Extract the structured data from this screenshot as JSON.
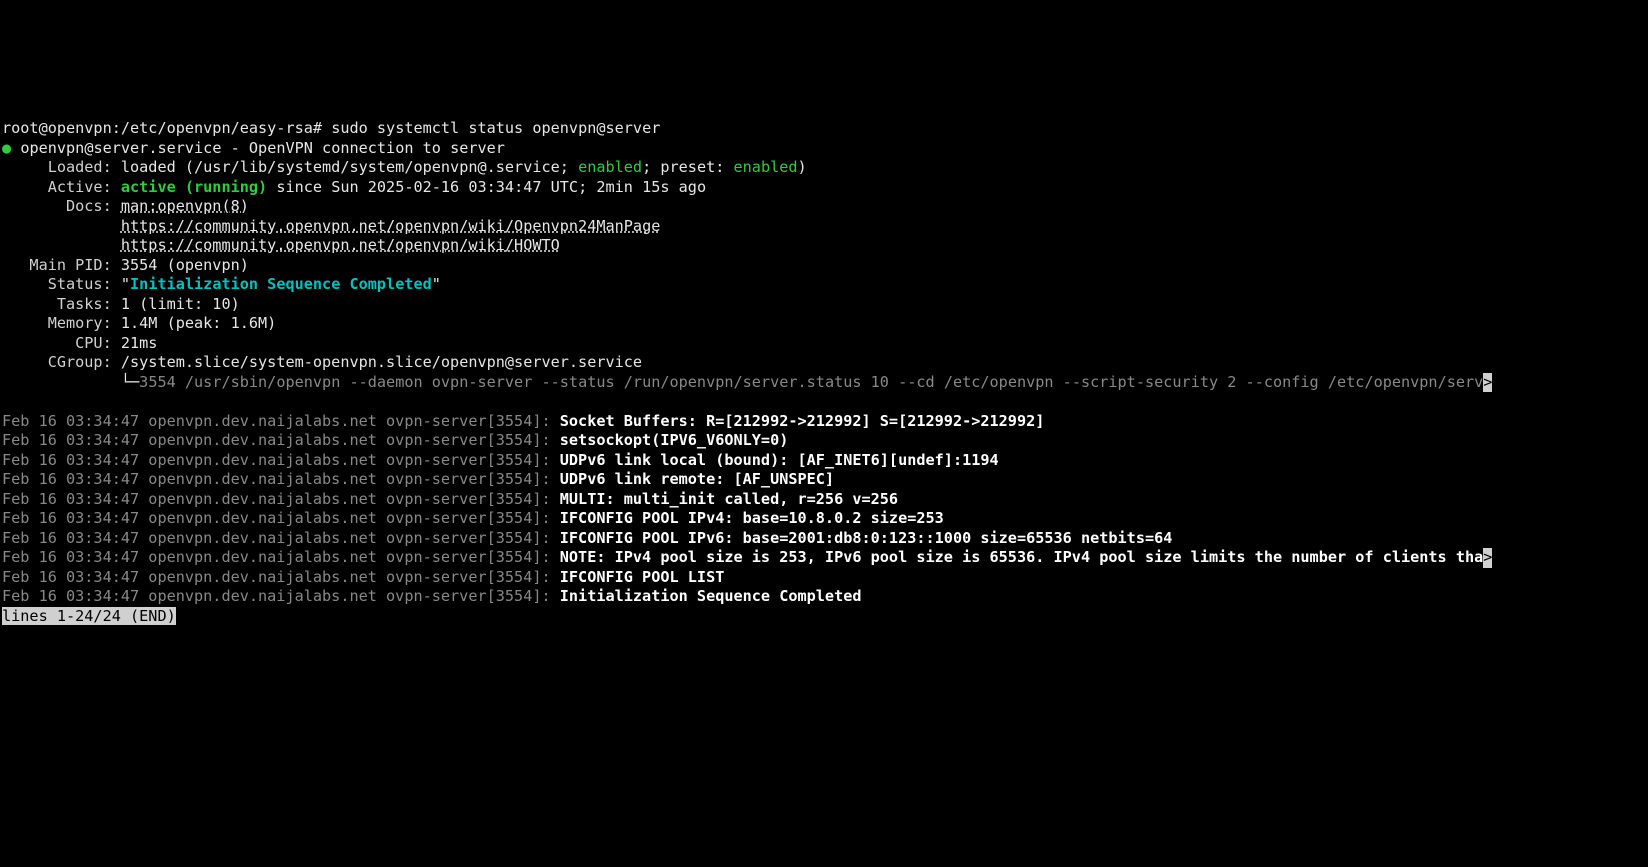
{
  "prompt": {
    "user_host_path": "root@openvpn:/etc/openvpn/easy-rsa#",
    "command": "sudo systemctl status openvpn@server"
  },
  "unit": {
    "dot": "●",
    "name": "openvpn@server.service - OpenVPN connection to server"
  },
  "loaded": {
    "label": "     Loaded: ",
    "pre": "loaded (/usr/lib/systemd/system/openvpn@.service; ",
    "enabled1": "enabled",
    "mid": "; preset: ",
    "enabled2": "enabled",
    "post": ")"
  },
  "active": {
    "label": "     Active: ",
    "state": "active (running)",
    "since": " since Sun 2025-02-16 03:34:47 UTC; 2min 15s ago"
  },
  "docs": {
    "label": "       Docs: ",
    "man": "man:openvpn(8)",
    "pad": "             ",
    "url1": "https://community.openvpn.net/openvpn/wiki/Openvpn24ManPage",
    "url2": "https://community.openvpn.net/openvpn/wiki/HOWTO"
  },
  "mainpid": {
    "label": "   Main PID: ",
    "value": "3554 (openvpn)"
  },
  "status": {
    "label": "     Status: ",
    "q1": "\"",
    "msg": "Initialization Sequence Completed",
    "q2": "\""
  },
  "tasks": {
    "label": "      Tasks: ",
    "value": "1 (limit: 10)"
  },
  "memory": {
    "label": "     Memory: ",
    "value": "1.4M (peak: 1.6M)"
  },
  "cpu": {
    "label": "        CPU: ",
    "value": "21ms"
  },
  "cgroup": {
    "label": "     CGroup: ",
    "value": "/system.slice/system-openvpn.slice/openvpn@server.service"
  },
  "processline": {
    "pad": "             ",
    "tree": "└─",
    "text": "3554 /usr/sbin/openvpn --daemon ovpn-server --status /run/openvpn/server.status 10 --cd /etc/openvpn --script-security 2 --config /etc/openvpn/serv",
    "more": ">"
  },
  "logs": {
    "prefix": "Feb 16 03:34:47 openvpn.dev.naijalabs.net ovpn-server[3554]: ",
    "lines": [
      "Socket Buffers: R=[212992->212992] S=[212992->212992]",
      "setsockopt(IPV6_V6ONLY=0)",
      "UDPv6 link local (bound): [AF_INET6][undef]:1194",
      "UDPv6 link remote: [AF_UNSPEC]",
      "MULTI: multi_init called, r=256 v=256",
      "IFCONFIG POOL IPv4: base=10.8.0.2 size=253",
      "IFCONFIG POOL IPv6: base=2001:db8:0:123::1000 size=65536 netbits=64",
      "NOTE: IPv4 pool size is 253, IPv6 pool size is 65536. IPv4 pool size limits the number of clients tha",
      "IFCONFIG POOL LIST",
      "Initialization Sequence Completed"
    ],
    "line8_more": ">"
  },
  "pager": {
    "status": "lines 1-24/24 (END)"
  }
}
